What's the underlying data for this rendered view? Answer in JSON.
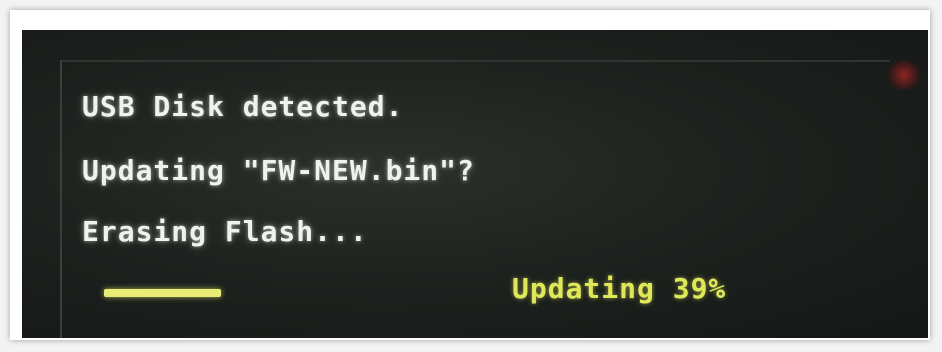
{
  "screen": {
    "lines": [
      "USB Disk detected.",
      "Updating \"FW-NEW.bin\"?",
      "Erasing Flash..."
    ],
    "status_label": "Updating 39%",
    "progress_fraction": 0.39
  },
  "colors": {
    "text": "#f0f2ee",
    "status_text": "#e0e85a",
    "progress_bar": "#e8ec74",
    "screen_background": "#1c201d"
  }
}
